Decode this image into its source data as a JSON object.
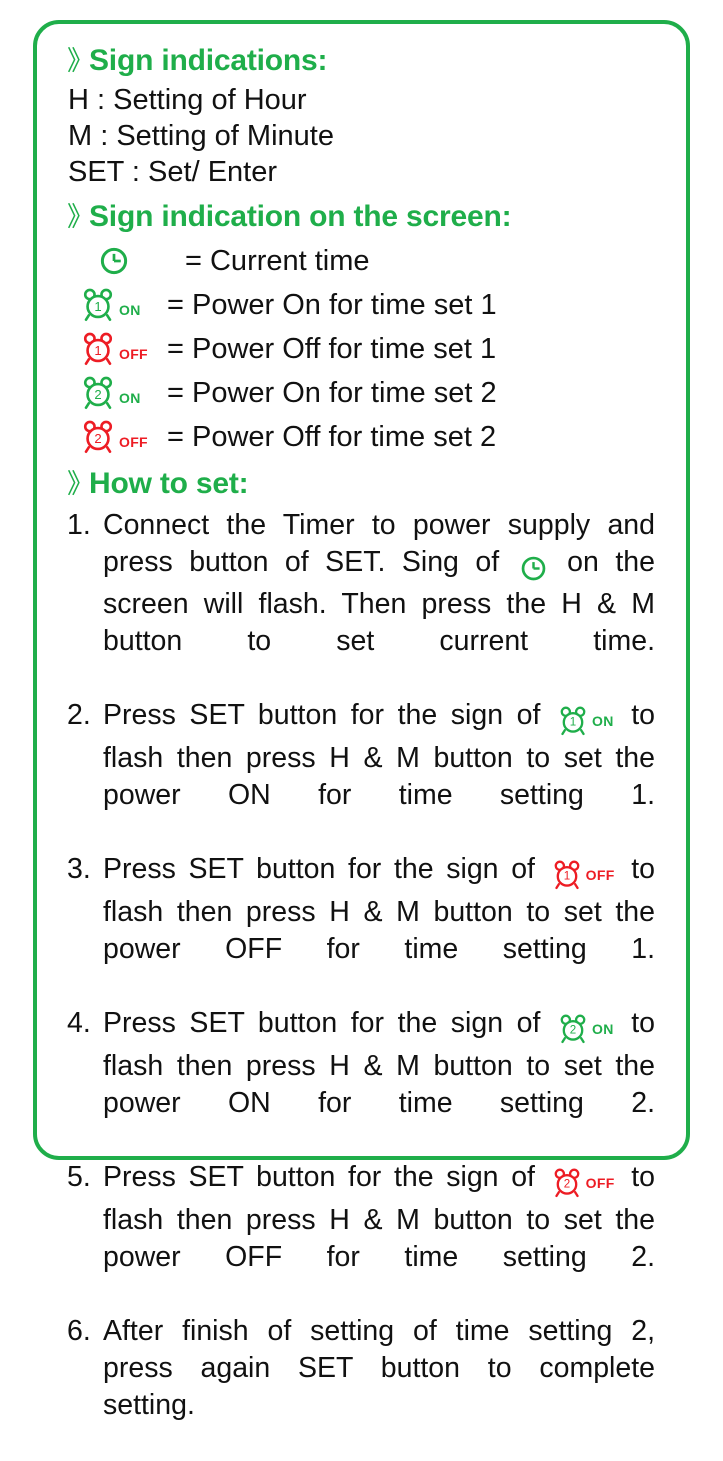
{
  "colors": {
    "green": "#1FAE4A",
    "red": "#ED1C24",
    "text": "#111111",
    "border": "#1FAE4A",
    "background": "#FFFFFF"
  },
  "card": {
    "bullet_glyph": "》"
  },
  "sections": {
    "sign_indications": {
      "heading": "Sign indications:",
      "lines": [
        "H : Setting of Hour",
        "M : Setting of Minute",
        "SET : Set/ Enter"
      ]
    },
    "sign_on_screen": {
      "heading": "Sign indication on the screen:",
      "rows": [
        {
          "icon": "clock-icon",
          "icon_color": "#1FAE4A",
          "badge": "",
          "digit": "",
          "text": "= Current time"
        },
        {
          "icon": "alarm-clock-icon",
          "icon_color": "#1FAE4A",
          "badge": "ON",
          "digit": "1",
          "text": "= Power On for time set 1"
        },
        {
          "icon": "alarm-clock-icon",
          "icon_color": "#ED1C24",
          "badge": "OFF",
          "digit": "1",
          "text": "= Power Off for time set 1"
        },
        {
          "icon": "alarm-clock-icon",
          "icon_color": "#1FAE4A",
          "badge": "ON",
          "digit": "2",
          "text": "= Power On for time set 2"
        },
        {
          "icon": "alarm-clock-icon",
          "icon_color": "#ED1C24",
          "badge": "OFF",
          "digit": "2",
          "text": "= Power Off for time set 2"
        }
      ]
    },
    "how_to_set": {
      "heading": "How to set:",
      "steps": [
        {
          "number": "1.",
          "text_before": "Connect the Timer to power supply and press button of SET. Sing of",
          "icon": "clock-icon",
          "icon_color": "#1FAE4A",
          "digit": "",
          "badge": "",
          "text_after": "on the screen will flash. Then press the H & M button to set current time."
        },
        {
          "number": "2.",
          "text_before": "Press SET button for the sign of",
          "icon": "alarm-clock-icon",
          "icon_color": "#1FAE4A",
          "digit": "1",
          "badge": "ON",
          "text_after": "to flash then press H & M button to set the power ON for time setting 1."
        },
        {
          "number": "3.",
          "text_before": "Press SET button for the sign of",
          "icon": "alarm-clock-icon",
          "icon_color": "#ED1C24",
          "digit": "1",
          "badge": "OFF",
          "text_after": "to flash then press H & M button to set the power OFF for time setting 1."
        },
        {
          "number": "4.",
          "text_before": "Press SET button for the sign of",
          "icon": "alarm-clock-icon",
          "icon_color": "#1FAE4A",
          "digit": "2",
          "badge": "ON",
          "text_after": "to flash then press H & M button to set the power ON for time setting 2."
        },
        {
          "number": "5.",
          "text_before": "Press SET button for the sign of",
          "icon": "alarm-clock-icon",
          "icon_color": "#ED1C24",
          "digit": "2",
          "badge": "OFF",
          "text_after": "to flash then press H & M button to set the power OFF for time setting 2."
        },
        {
          "number": "6.",
          "text_before": "After finish of setting of time setting 2, press again SET button to complete setting.",
          "icon": "",
          "icon_color": "",
          "digit": "",
          "badge": "",
          "text_after": ""
        }
      ]
    }
  }
}
